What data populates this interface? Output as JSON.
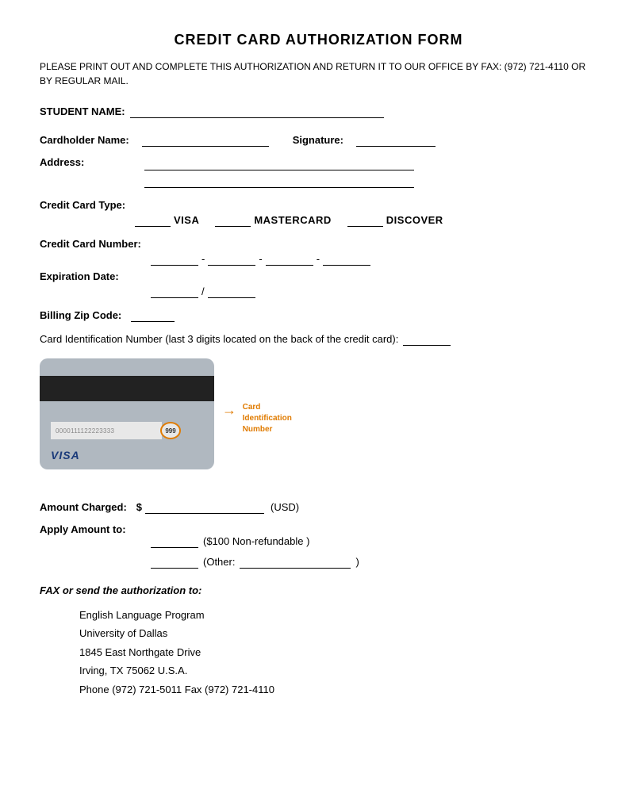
{
  "title": "CREDIT CARD AUTHORIZATION FORM",
  "instructions": "PLEASE PRINT OUT AND COMPLETE THIS AUTHORIZATION AND RETURN IT TO OUR OFFICE BY FAX: (972) 721-4110 OR BY REGULAR MAIL.",
  "fields": {
    "student_name_label": "STUDENT NAME:",
    "cardholder_name_label": "Cardholder Name:",
    "signature_label": "Signature:",
    "address_label": "Address:",
    "cc_type_label": "Credit Card Type:",
    "visa_label": "VISA",
    "mastercard_label": "MASTERCARD",
    "discover_label": "DISCOVER",
    "cc_number_label": "Credit Card Number:",
    "expiration_label": "Expiration Date:",
    "billing_zip_label": "Billing Zip Code:",
    "card_id_label": "Card Identification Number (last 3 digits located on the back of the credit card):",
    "amount_label": "Amount Charged:",
    "dollar_sign": "$",
    "usd_label": "(USD)",
    "apply_amount_label": "Apply Amount to:",
    "non_refundable_label": "($100 Non-refundable )",
    "other_label": "(Other:",
    "other_close": ")",
    "fax_label": "FAX or send the authorization to:",
    "org_name": "English Language Program",
    "university": "University of Dallas",
    "street": "1845 East Northgate Drive",
    "city_state": "Irving, TX 75062     U.S.A.",
    "phone_fax": "Phone (972) 721-5011   Fax (972) 721-4110"
  },
  "cc_image": {
    "card_number_display": "0000111122223333",
    "cvv_display": "999",
    "brand": "VISA",
    "arrow_label": "Card\nIdentification\nNumber"
  }
}
